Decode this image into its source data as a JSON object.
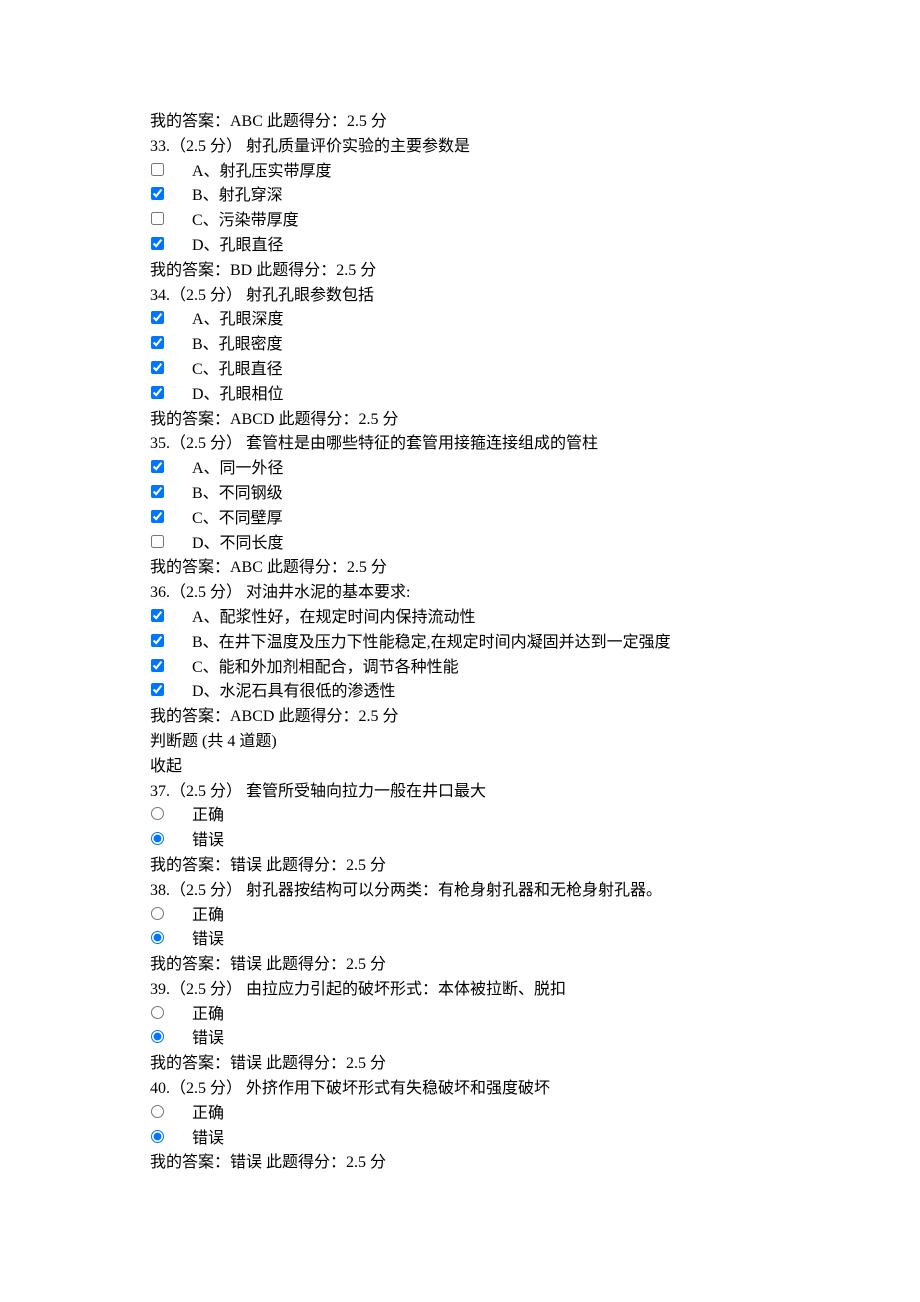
{
  "labels": {
    "correct": "正确",
    "incorrect": "错误"
  },
  "q32_answer": "我的答案：ABC 此题得分：2.5 分",
  "q33": {
    "title": "33.（2.5 分）  射孔质量评价实验的主要参数是",
    "options": [
      {
        "checked": false,
        "text": "A、射孔压实带厚度"
      },
      {
        "checked": true,
        "text": "B、射孔穿深"
      },
      {
        "checked": false,
        "text": "C、污染带厚度"
      },
      {
        "checked": true,
        "text": "D、孔眼直径"
      }
    ],
    "answer": "我的答案：BD 此题得分：2.5 分"
  },
  "q34": {
    "title": "34.（2.5 分）  射孔孔眼参数包括",
    "options": [
      {
        "checked": true,
        "text": "A、孔眼深度"
      },
      {
        "checked": true,
        "text": "B、孔眼密度"
      },
      {
        "checked": true,
        "text": "C、孔眼直径"
      },
      {
        "checked": true,
        "text": "D、孔眼相位"
      }
    ],
    "answer": "我的答案：ABCD 此题得分：2.5 分"
  },
  "q35": {
    "title": "35.（2.5 分）  套管柱是由哪些特征的套管用接箍连接组成的管柱",
    "options": [
      {
        "checked": true,
        "text": "A、同一外径"
      },
      {
        "checked": true,
        "text": "B、不同钢级"
      },
      {
        "checked": true,
        "text": "C、不同壁厚"
      },
      {
        "checked": false,
        "text": "D、不同长度"
      }
    ],
    "answer": "我的答案：ABC 此题得分：2.5 分"
  },
  "q36": {
    "title": "36.（2.5 分）  对油井水泥的基本要求:",
    "options": [
      {
        "checked": true,
        "text": "A、配浆性好，在规定时间内保持流动性"
      },
      {
        "checked": true,
        "text": "B、在井下温度及压力下性能稳定,在规定时间内凝固并达到一定强度"
      },
      {
        "checked": true,
        "text": "C、能和外加剂相配合，调节各种性能"
      },
      {
        "checked": true,
        "text": "D、水泥石具有很低的渗透性"
      }
    ],
    "answer": "我的答案：ABCD 此题得分：2.5 分"
  },
  "tf_header": "判断题 (共 4 道题)",
  "collapse": "收起",
  "q37": {
    "title": "37.（2.5 分）  套管所受轴向拉力一般在井口最大",
    "selected": "incorrect",
    "answer": "我的答案：错误 此题得分：2.5 分"
  },
  "q38": {
    "title": "38.（2.5 分）  射孔器按结构可以分两类：有枪身射孔器和无枪身射孔器。",
    "selected": "incorrect",
    "answer": "我的答案：错误 此题得分：2.5 分"
  },
  "q39": {
    "title": "39.（2.5 分）  由拉应力引起的破坏形式：本体被拉断、脱扣",
    "selected": "incorrect",
    "answer": "我的答案：错误 此题得分：2.5 分"
  },
  "q40": {
    "title": "40.（2.5 分）  外挤作用下破坏形式有失稳破坏和强度破坏",
    "selected": "incorrect",
    "answer": "我的答案：错误 此题得分：2.5 分"
  }
}
